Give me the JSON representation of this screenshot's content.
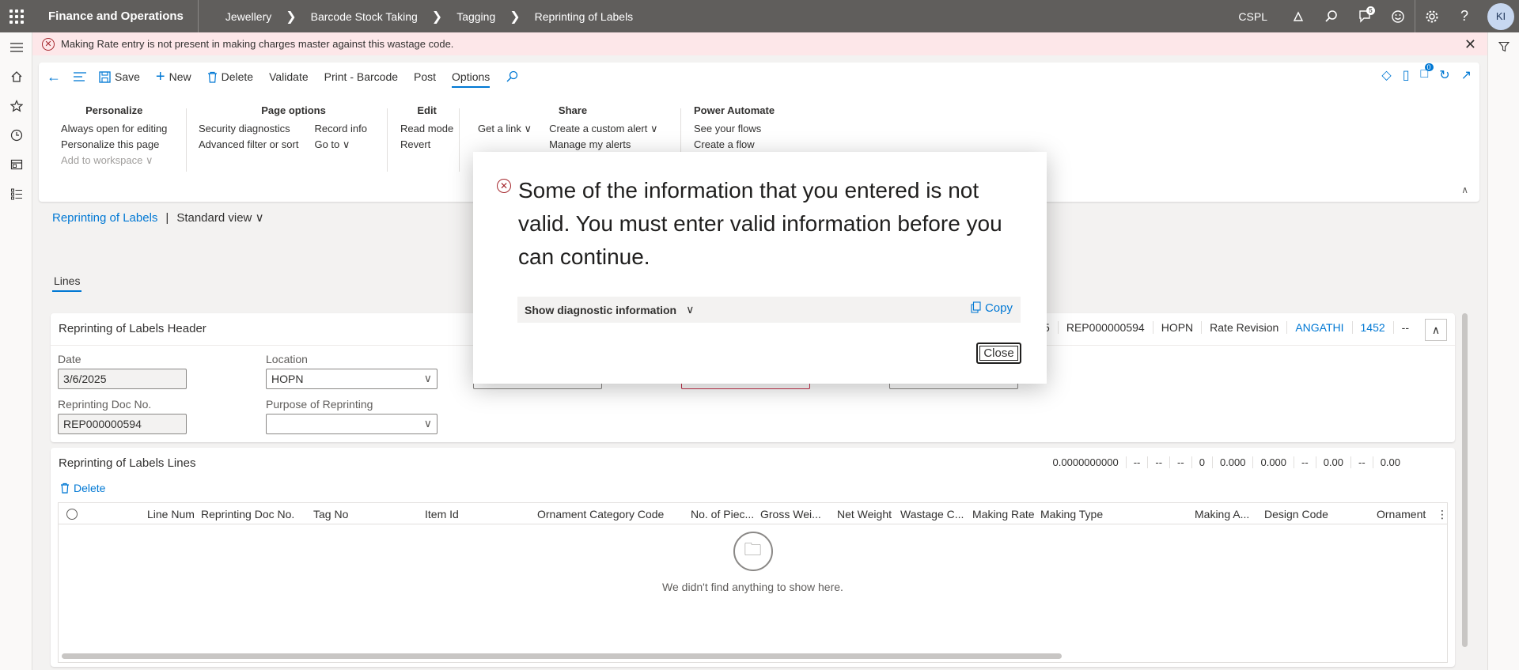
{
  "topbar": {
    "app_title": "Finance and Operations",
    "breadcrumb": [
      "Jewellery",
      "Barcode Stock Taking",
      "Tagging",
      "Reprinting of Labels"
    ],
    "company": "CSPL",
    "notification_count": "5",
    "avatar_initials": "KI"
  },
  "error_banner": {
    "message": "Making Rate entry is not present in making charges master against this wastage code."
  },
  "toolbar": {
    "save": "Save",
    "new": "New",
    "delete": "Delete",
    "validate": "Validate",
    "print_barcode": "Print - Barcode",
    "post": "Post",
    "options": "Options",
    "attachments_count": "0"
  },
  "options_groups": {
    "personalize": {
      "title": "Personalize",
      "items": [
        "Always open for editing",
        "Personalize this page",
        "Add to workspace"
      ]
    },
    "page_options": {
      "title": "Page options",
      "col1": [
        "Security diagnostics",
        "Advanced filter or sort"
      ],
      "col2": [
        "Record info",
        "Go to"
      ]
    },
    "edit": {
      "title": "Edit",
      "items": [
        "Read mode",
        "Revert"
      ]
    },
    "share": {
      "title": "Share",
      "get_link": "Get a link",
      "items": [
        "Create a custom alert",
        "Manage my alerts"
      ]
    },
    "power_automate": {
      "title": "Power Automate",
      "items": [
        "See your flows",
        "Create a flow"
      ]
    }
  },
  "page": {
    "crumb_link": "Reprinting of Labels",
    "view": "Standard view",
    "tab": "Lines"
  },
  "header_card": {
    "title": "Reprinting of Labels Header",
    "summary": [
      "/2025",
      "REP000000594",
      "HOPN",
      "Rate Revision",
      "ANGATHI",
      "1452",
      "--"
    ],
    "fields": {
      "date_label": "Date",
      "date_value": "3/6/2025",
      "location_label": "Location",
      "location_value": "HOPN",
      "doc_label": "Reprinting Doc No.",
      "doc_value": "REP000000594",
      "purpose_label": "Purpose of Reprinting",
      "purpose_value": ""
    }
  },
  "lines_card": {
    "title": "Reprinting of Labels Lines",
    "totals": [
      "0.0000000000",
      "--",
      "--",
      "--",
      "0",
      "0.000",
      "0.000",
      "--",
      "0.00",
      "--",
      "0.00"
    ],
    "delete": "Delete",
    "columns": [
      "Line Num",
      "Reprinting Doc No.",
      "Tag No",
      "Item Id",
      "Ornament Category Code",
      "No. of Piec...",
      "Gross Wei...",
      "Net Weight",
      "Wastage C...",
      "Making Rate",
      "Making Type",
      "Making A...",
      "Design Code",
      "Ornament"
    ],
    "empty_text": "We didn't find anything to show here."
  },
  "dialog": {
    "message": "Some of the information that you entered is not valid. You must enter valid information before you can continue.",
    "diagnostic": "Show diagnostic information",
    "copy": "Copy",
    "close": "Close"
  }
}
